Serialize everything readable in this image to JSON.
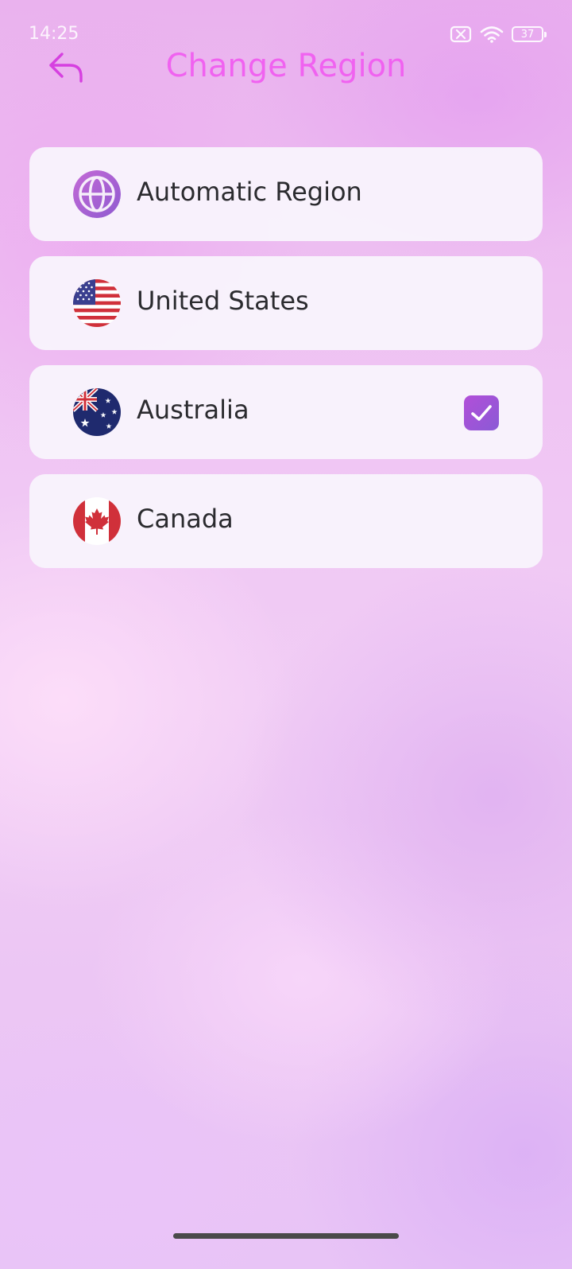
{
  "status_bar": {
    "time": "14:25",
    "battery_level": "37",
    "icons": [
      "notification-muted-icon",
      "wifi-icon",
      "battery-icon"
    ]
  },
  "header": {
    "title": "Change Region",
    "back_icon": "back-arrow-icon"
  },
  "regions": [
    {
      "label": "Automatic Region",
      "icon": "globe-icon",
      "selected": false
    },
    {
      "label": "United States",
      "icon": "us-flag-icon",
      "selected": false
    },
    {
      "label": "Australia",
      "icon": "australia-flag-icon",
      "selected": true
    },
    {
      "label": "Canada",
      "icon": "canada-flag-icon",
      "selected": false
    }
  ],
  "colors": {
    "accent": "#f062f0",
    "check_gradient_start": "#b24fd8",
    "check_gradient_end": "#8a5ad6",
    "card_background": "#f8f4fc",
    "label_text": "#2b2b2f"
  }
}
